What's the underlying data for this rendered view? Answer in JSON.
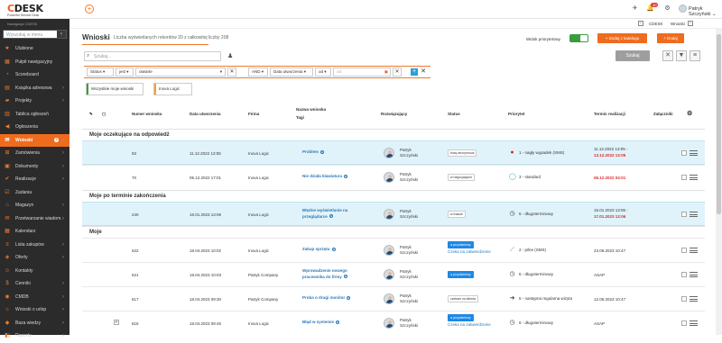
{
  "brand": {
    "name_main": "CDESK",
    "tagline": "Powerful Service Desk"
  },
  "topbar": {
    "notif_count": "30",
    "user": "Patryk Szczyński",
    "user_caret": "⌄"
  },
  "breadcrumb": {
    "items": [
      "CDESK",
      "Wnioski"
    ]
  },
  "sidebar": {
    "nav_label": "Nawigacja CDESK",
    "search_placeholder": "Wyszukaj w menu",
    "items": [
      {
        "label": "Ulubione",
        "icon": "star-icon"
      },
      {
        "label": "Pulpit nawigacyjny",
        "icon": "dashboard-icon"
      },
      {
        "label": "Scoreboard",
        "icon": "chart-icon"
      },
      {
        "label": "Książka adresowa",
        "icon": "book-icon"
      },
      {
        "label": "Projekty",
        "icon": "folder-icon"
      },
      {
        "label": "Tablica ogłoszeń",
        "icon": "board-icon"
      },
      {
        "label": "Ogłoszenia",
        "icon": "megaphone-icon"
      },
      {
        "label": "Wnioski",
        "icon": "inbox-icon",
        "badge": "4"
      },
      {
        "label": "Zamówienia",
        "icon": "cart-icon"
      },
      {
        "label": "Dokumenty",
        "icon": "document-icon"
      },
      {
        "label": "Realizacje",
        "icon": "check-icon"
      },
      {
        "label": "Zadania",
        "icon": "task-icon"
      },
      {
        "label": "Magazyn",
        "icon": "warehouse-icon"
      },
      {
        "label": "Przetwarzanie wiadom.",
        "icon": "mail-icon"
      },
      {
        "label": "Kalendarz",
        "icon": "calendar-icon"
      },
      {
        "label": "Lista zakupów",
        "icon": "list-icon"
      },
      {
        "label": "Oferty",
        "icon": "offer-icon"
      },
      {
        "label": "Kontakty",
        "icon": "contacts-icon"
      },
      {
        "label": "Cenniki",
        "icon": "price-icon"
      },
      {
        "label": "CMDB",
        "icon": "database-icon"
      },
      {
        "label": "Wnioski o urlop",
        "icon": "leave-icon"
      },
      {
        "label": "Baza wiedzy",
        "icon": "knowledge-icon"
      },
      {
        "label": "Raporty",
        "icon": "report-icon"
      }
    ]
  },
  "page": {
    "title": "Wnioski",
    "subtitle": "Liczba wyświetlanych rekordów 20 z całkowitej liczby 208",
    "priority_view_label": "Widok priorytetowy",
    "add_from_catalog": "+ Dodaj z katalogu",
    "add": "+ Dodaj",
    "search_placeholder": "Szukaj...",
    "search_button": "Szukaj"
  },
  "filters": {
    "field": "Status",
    "op": "jest",
    "value": "otwarte",
    "logic": "AND",
    "date_field": "Data utworzenia",
    "date_op": "od",
    "date_placeholder": "od"
  },
  "chips": [
    "Wszystkie moje wnioski",
    "Inova Logic"
  ],
  "table": {
    "headers": [
      "Numer wniosku",
      "Data utworzenia",
      "Firma",
      "Nazwa wniosku",
      "Tagi",
      "Rozwiązujący",
      "Status",
      "Priorytet",
      "Termin realizacji",
      "Załączniki"
    ],
    "groups": [
      {
        "name": "Moje oczekujące na odpowiedź",
        "rows": [
          {
            "num": "93",
            "date": "11.12.2022 13:05",
            "firma": "Inova Logic",
            "name": "Problem",
            "solver_first": "Patryk",
            "solver_last": "Szczyński",
            "status": "busy anonymous",
            "priority": "1 - nagły wypadek (SMS)",
            "deadline1": "11.12.2022 13:05 -",
            "deadline2": "13.12.2022 13:05",
            "hl": true
          },
          {
            "num": "70",
            "date": "05.12.2022 17:01",
            "firma": "Inova Logic",
            "name": "Nie działa klawiatura",
            "solver_first": "Patryk",
            "solver_last": "Szczyński",
            "status": "w negocjacjach",
            "priority": "3 - standard",
            "deadline1": "06.12.2022 04:01",
            "deadline2": ""
          }
        ]
      },
      {
        "name": "Moje po terminie zakończenia",
        "rows": [
          {
            "num": "240",
            "date": "15.01.2023 13:06",
            "firma": "Inova Logic",
            "name": "Błędne wyświetlanie na przeglądarce",
            "solver_first": "Patryk",
            "solver_last": "Szczyński",
            "status": "w trakcie",
            "priority": "6 - długoterminowy",
            "deadline1": "15.01.2023 13:06 -",
            "deadline2": "17.01.2023 13:06",
            "hl": true
          }
        ]
      },
      {
        "name": "Moje",
        "rows": [
          {
            "num": "622",
            "date": "18.04.2023 10:02",
            "firma": "Inova Logic",
            "name": "Zakup sprzętu",
            "solver_first": "Patryk",
            "solver_last": "Szczyński",
            "status": "przydzielony",
            "status_sub": "Czeka na zatwierdzenie",
            "priority": "2 - pilne (SMS)",
            "deadline1": "23.06.2023 10:47",
            "deadline2": ""
          },
          {
            "num": "621",
            "date": "18.04.2023 10:03",
            "firma": "Patryk Company",
            "name": "Wprowadzenie nowego pracownika do firmy",
            "solver_first": "Patryk",
            "solver_last": "Szczyński",
            "status": "przydzielony",
            "priority": "6 - długoterminowy",
            "deadline1": "ASAP",
            "deadline2": ""
          },
          {
            "num": "617",
            "date": "18.04.2023 09:30",
            "firma": "Patryk Company",
            "name": "Proba o drugi monitor",
            "solver_first": "Patryk",
            "solver_last": "Szczyński",
            "status": "czekam na klienta",
            "priority": "5 - następna regularna wizyta",
            "deadline1": "12.06.2023 10:47",
            "deadline2": ""
          },
          {
            "num": "616",
            "date": "18.04.2023 09:46",
            "firma": "Inova Logic",
            "name": "Błąd w systemie",
            "solver_first": "Patryk",
            "solver_last": "Szczyński",
            "status": "przydzielony",
            "status_sub": "Czeka na zatwierdzenie",
            "priority": "6 - długoterminowy",
            "deadline1": "ASAP",
            "deadline2": ""
          }
        ]
      }
    ]
  }
}
